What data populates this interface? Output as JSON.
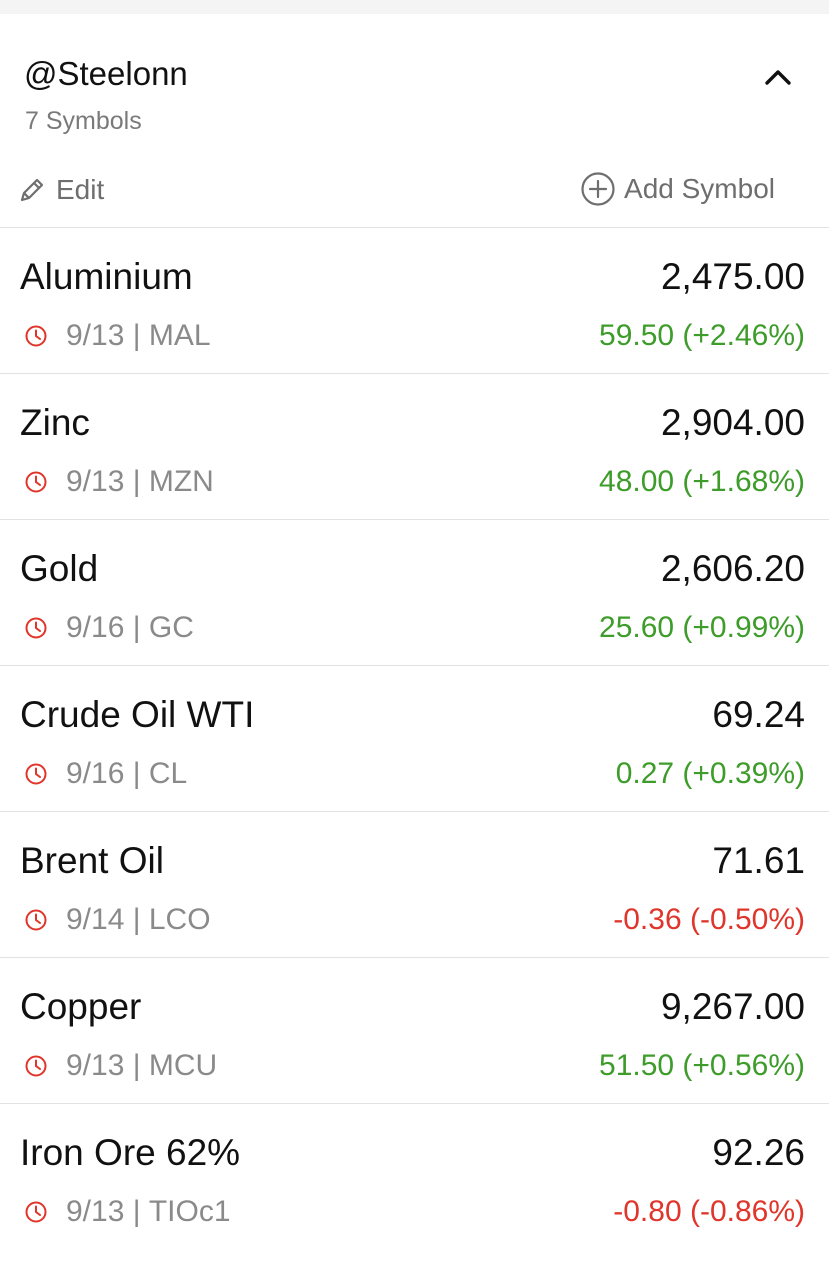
{
  "watchlist": {
    "title": "@Steelonn",
    "symbol_count": "7 Symbols",
    "collapse_icon": "chevron-up-icon",
    "edit_label": "Edit",
    "edit_icon": "pencil-icon",
    "add_label": "Add Symbol",
    "add_icon": "plus-circle-icon"
  },
  "colors": {
    "positive": "#3d9c2a",
    "negative": "#e0352b",
    "clock_icon": "#e0352b"
  },
  "rows": [
    {
      "name": "Aluminium",
      "price": "2,475.00",
      "date": "9/13",
      "symbol": "MAL",
      "change": "59.50 (+2.46%)",
      "direction": "up"
    },
    {
      "name": "Zinc",
      "price": "2,904.00",
      "date": "9/13",
      "symbol": "MZN",
      "change": "48.00 (+1.68%)",
      "direction": "up"
    },
    {
      "name": "Gold",
      "price": "2,606.20",
      "date": "9/16",
      "symbol": "GC",
      "change": "25.60 (+0.99%)",
      "direction": "up"
    },
    {
      "name": "Crude Oil WTI",
      "price": "69.24",
      "date": "9/16",
      "symbol": "CL",
      "change": "0.27 (+0.39%)",
      "direction": "up"
    },
    {
      "name": "Brent Oil",
      "price": "71.61",
      "date": "9/14",
      "symbol": "LCO",
      "change": "-0.36 (-0.50%)",
      "direction": "down"
    },
    {
      "name": "Copper",
      "price": "9,267.00",
      "date": "9/13",
      "symbol": "MCU",
      "change": "51.50 (+0.56%)",
      "direction": "up"
    },
    {
      "name": "Iron Ore 62%",
      "price": "92.26",
      "date": "9/13",
      "symbol": "TIOc1",
      "change": "-0.80 (-0.86%)",
      "direction": "down"
    }
  ]
}
